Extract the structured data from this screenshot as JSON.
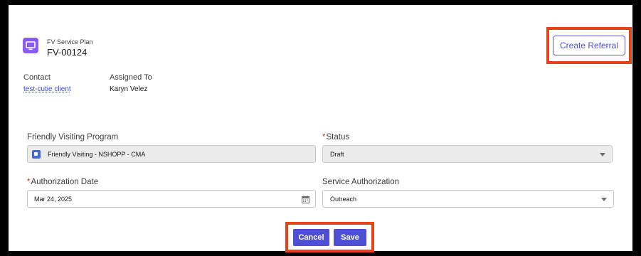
{
  "record": {
    "object_label": "FV Service Plan",
    "name": "FV-00124",
    "icon": "record-icon"
  },
  "actions": {
    "create_referral": "Create Referral"
  },
  "highlights": {
    "contact_label": "Contact",
    "contact_value": "test-cutie client",
    "assigned_label": "Assigned To",
    "assigned_value": "Karyn Velez"
  },
  "form": {
    "program_label": "Friendly Visiting Program",
    "program_value": "Friendly Visiting - NSHOPP - CMA",
    "status_label": "Status",
    "status_value": "Draft",
    "auth_date_label": "Authorization Date",
    "auth_date_value": "Mar 24, 2025",
    "service_auth_label": "Service Authorization",
    "service_auth_value": "Outreach",
    "required_marker": "*"
  },
  "footer": {
    "cancel": "Cancel",
    "save": "Save"
  },
  "colors": {
    "brand": "#4f4fd6",
    "highlight_frame": "#e8421b",
    "record_icon": "#8a5cf6",
    "required": "#c23934"
  }
}
